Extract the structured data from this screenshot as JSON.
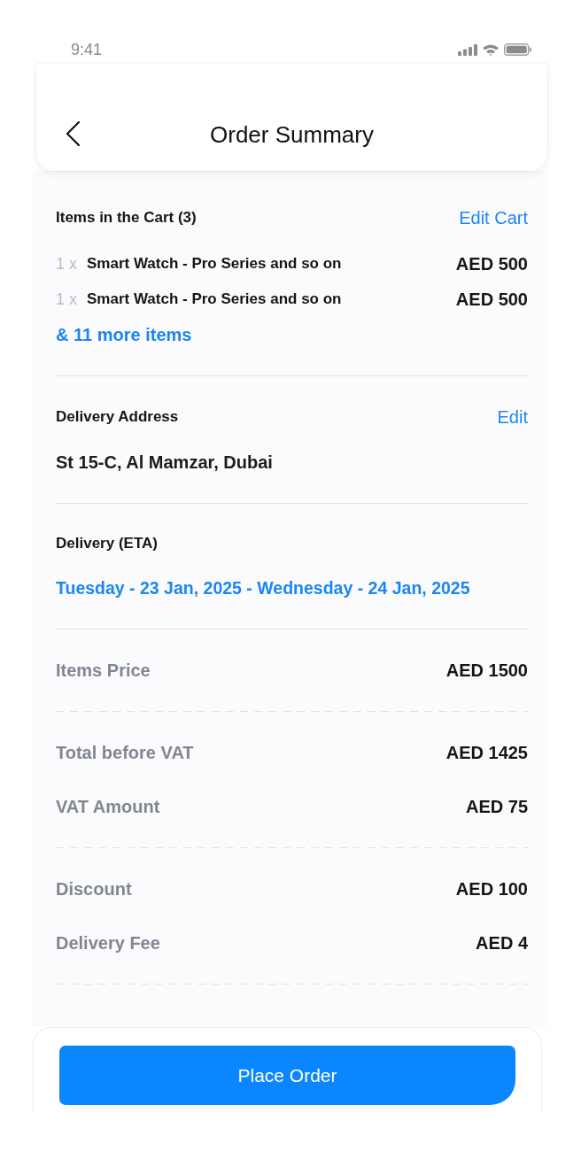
{
  "status_bar": {
    "time": "9:41"
  },
  "header": {
    "title": "Order Summary"
  },
  "cart": {
    "title": "Items in the Cart (3)",
    "edit_label": "Edit Cart",
    "items": [
      {
        "quantity": "1 x",
        "name": "Smart Watch - Pro Series and so on",
        "price": "AED 500"
      },
      {
        "quantity": "1 x",
        "name": "Smart Watch - Pro Series and so on",
        "price": "AED 500"
      }
    ],
    "more_link": "& 11 more items"
  },
  "delivery_address": {
    "title": "Delivery Address",
    "edit_label": "Edit",
    "address": "St 15-C, Al Mamzar, Dubai"
  },
  "delivery_eta": {
    "title": "Delivery (ETA)",
    "date_range": "Tuesday - 23 Jan, 2025 - Wednesday - 24 Jan, 2025"
  },
  "price_groups": [
    {
      "rows": [
        {
          "label": "Items Price",
          "value": "AED 1500"
        }
      ]
    },
    {
      "rows": [
        {
          "label": "Total before VAT",
          "value": "AED 1425"
        },
        {
          "label": "VAT Amount",
          "value": "AED 75"
        }
      ]
    },
    {
      "rows": [
        {
          "label": "Discount",
          "value": "AED 100"
        },
        {
          "label": "Delivery Fee",
          "value": "AED 4"
        }
      ]
    }
  ],
  "place_order_button": {
    "label": "Place Order"
  }
}
